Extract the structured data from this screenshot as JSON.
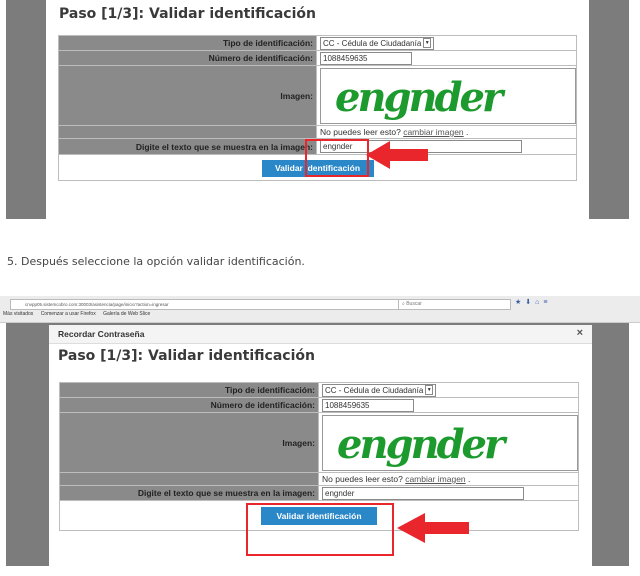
{
  "step_title": "Paso [1/3]: Validar identificación",
  "form": {
    "tipo_label": "Tipo de identificación:",
    "tipo_value": "CC - Cédula de Ciudadanía",
    "numero_label": "Número de identificación:",
    "numero_value": "1088459635",
    "imagen_label": "Imagen:",
    "captcha_text": "engnder",
    "no_puedes": "No puedes leer esto?",
    "cambiar_imagen": "cambiar imagen",
    "punto": ".",
    "digite_label": "Digite el texto que se muestra en la imagen:",
    "digite_value": "engnder",
    "validar_button": "Validar identificación"
  },
  "instruction": "5. Después seleccione la opción validar identificación.",
  "browser": {
    "url": "cnvpp05.sistemcobro.com:30003/asistencia/page/inicio?action=ingresar",
    "search_placeholder": "Buscar",
    "bookmarks": [
      "Más visitados",
      "Comenzar a usar Firefox",
      "Galería de Web Slice"
    ]
  },
  "modal": {
    "title": "Recordar Contraseña",
    "close": "×"
  },
  "colors": {
    "button": "#2a88c9",
    "highlight": "#e8262b",
    "captcha": "#1d9a2d"
  }
}
